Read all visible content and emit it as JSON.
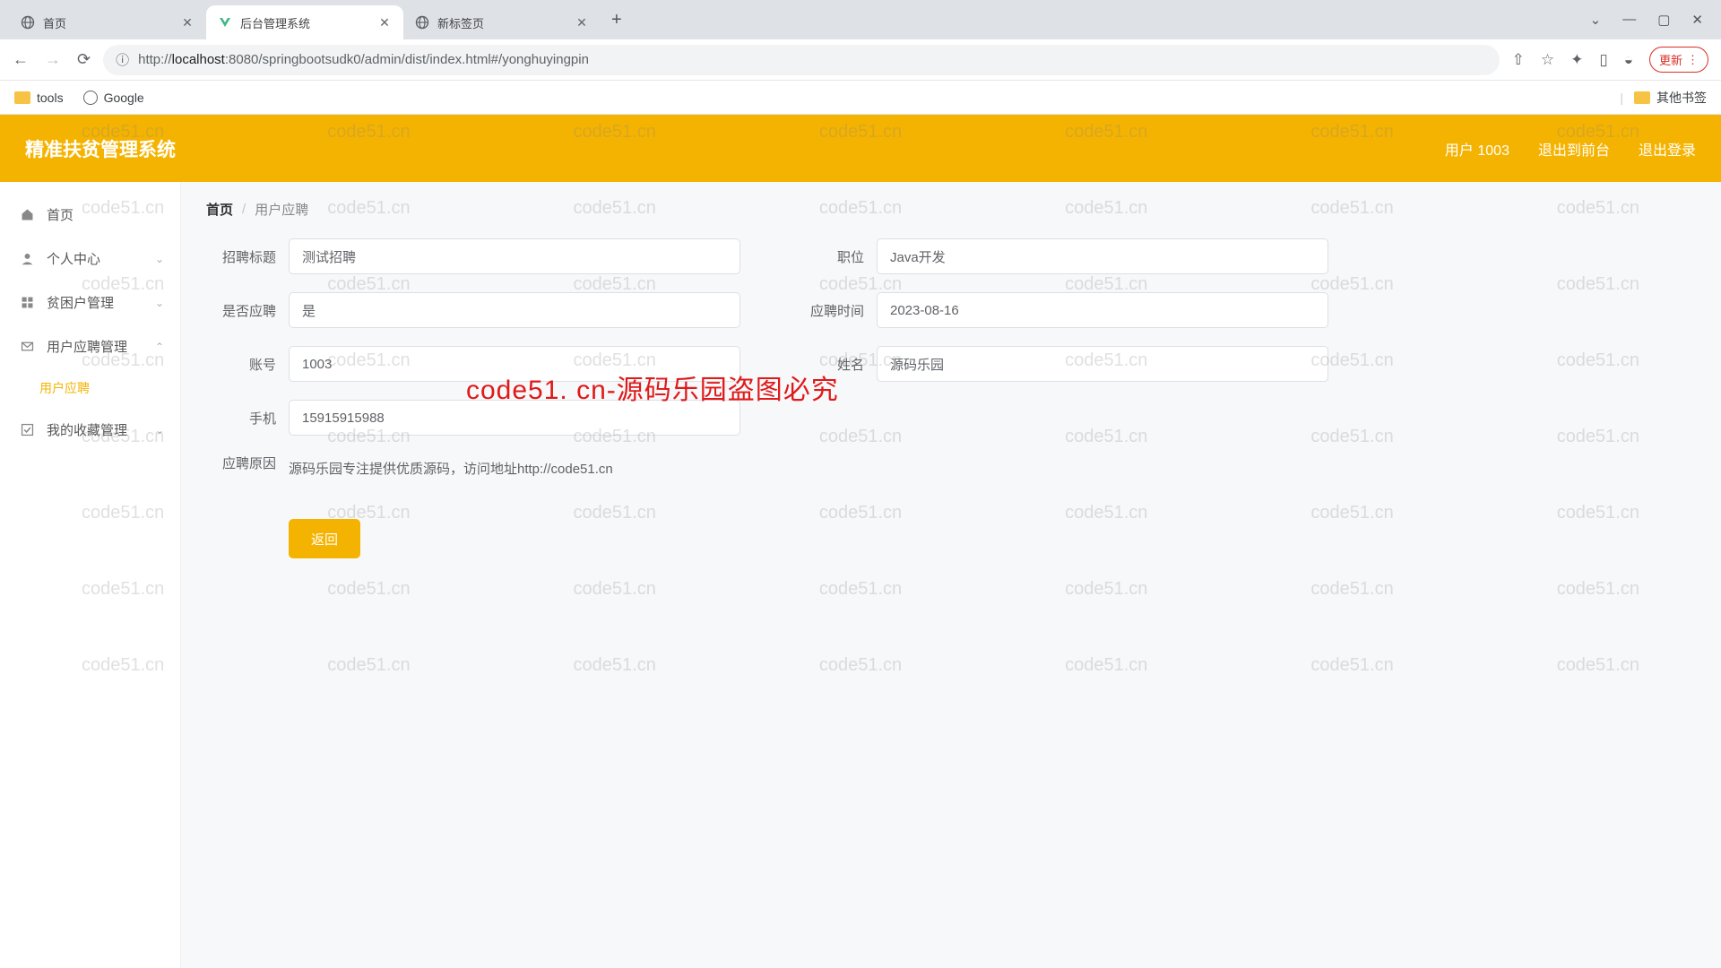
{
  "browser": {
    "tabs": [
      {
        "title": "首页",
        "active": false
      },
      {
        "title": "后台管理系统",
        "active": true
      },
      {
        "title": "新标签页",
        "active": false
      }
    ],
    "url_prefix": "http://",
    "url_host": "localhost",
    "url_path": ":8080/springbootsudk0/admin/dist/index.html#/yonghuyingpin",
    "update": "更新",
    "bookmarks": {
      "tools": "tools",
      "google": "Google",
      "other": "其他书签"
    }
  },
  "app": {
    "title": "精准扶贫管理系统",
    "header_right": {
      "user": "用户 1003",
      "back_front": "退出到前台",
      "logout": "退出登录"
    }
  },
  "sidebar": {
    "home": "首页",
    "personal": "个人中心",
    "poverty": "贫困户管理",
    "apply_mgmt": "用户应聘管理",
    "apply_sub": "用户应聘",
    "favorites": "我的收藏管理"
  },
  "breadcrumb": {
    "home": "首页",
    "current": "用户应聘",
    "sep": "/"
  },
  "form": {
    "recruit_title_label": "招聘标题",
    "recruit_title": "测试招聘",
    "position_label": "职位",
    "position": "Java开发",
    "is_apply_label": "是否应聘",
    "is_apply": "是",
    "apply_time_label": "应聘时间",
    "apply_time": "2023-08-16",
    "account_label": "账号",
    "account": "1003",
    "name_label": "姓名",
    "name": "源码乐园",
    "phone_label": "手机",
    "phone": "15915915988",
    "reason_label": "应聘原因",
    "reason": "源码乐园专注提供优质源码，访问地址http://code51.cn",
    "back_btn": "返回"
  },
  "watermark": {
    "text": "code51.cn",
    "center": "code51. cn-源码乐园盗图必究"
  }
}
